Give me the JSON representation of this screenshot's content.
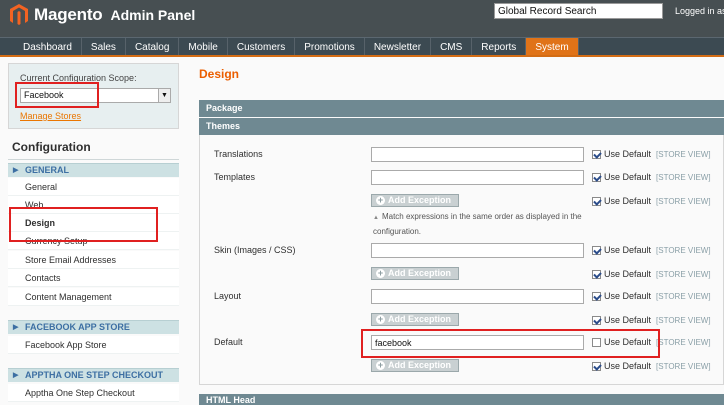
{
  "header": {
    "logo_text": "Magento",
    "logo_sub": "Admin Panel",
    "search_value": "Global Record Search",
    "logged_in": "Logged in as"
  },
  "nav": {
    "items": [
      "Dashboard",
      "Sales",
      "Catalog",
      "Mobile",
      "Customers",
      "Promotions",
      "Newsletter",
      "CMS",
      "Reports",
      "System"
    ],
    "active": "System"
  },
  "sidebar": {
    "scope_label": "Current Configuration Scope:",
    "scope_value": "Facebook",
    "manage_stores": "Manage Stores",
    "config_title": "Configuration",
    "groups": [
      {
        "title": "GENERAL",
        "items": [
          "General",
          "Web",
          "Design",
          "Currency Setup",
          "Store Email Addresses",
          "Contacts",
          "Content Management"
        ]
      },
      {
        "title": "FACEBOOK APP STORE",
        "items": [
          "Facebook App Store"
        ]
      },
      {
        "title": "APPTHA ONE STEP CHECKOUT",
        "items": [
          "Apptha One Step Checkout"
        ]
      }
    ],
    "active_item": "Design"
  },
  "main": {
    "title": "Design",
    "sections": {
      "package": "Package",
      "themes": "Themes",
      "html_head": "HTML Head"
    },
    "rows": {
      "translations": {
        "label": "Translations",
        "value": ""
      },
      "templates": {
        "label": "Templates",
        "value": ""
      },
      "skin": {
        "label": "Skin (Images / CSS)",
        "value": ""
      },
      "layout": {
        "label": "Layout",
        "value": ""
      },
      "default": {
        "label": "Default",
        "value": "facebook"
      }
    },
    "add_exception": "Add Exception",
    "hint": "Match expressions in the same order as displayed in the configuration.",
    "use_default": "Use Default",
    "store_view": "[STORE VIEW]"
  },
  "colors": {
    "header_bg": "#474f52",
    "nav_active": "#e07318",
    "title_orange": "#eb5e00",
    "highlight_red": "#e02020"
  }
}
